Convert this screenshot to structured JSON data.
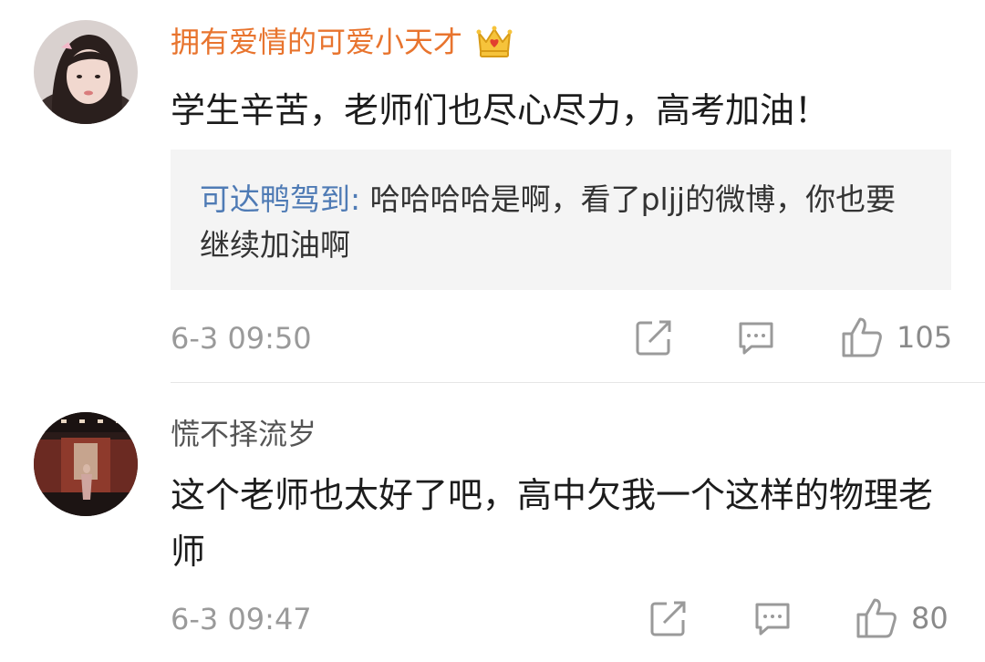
{
  "comments": [
    {
      "username": "拥有爱情的可爱小天才",
      "username_color": "#e8742e",
      "badge_icon": "crown-icon",
      "text": "学生辛苦，老师们也尽心尽力，高考加油！",
      "reply": {
        "author": "可达鸭驾到",
        "separator": ":",
        "text": " 哈哈哈哈是啊，看了pljj的微博，你也要继续加油啊"
      },
      "time": "6-3 09:50",
      "actions": {
        "share_icon": "share-icon",
        "comment_icon": "comment-icon",
        "like_icon": "thumbs-up-icon"
      },
      "likes": "105"
    },
    {
      "username": "慌不择流岁",
      "username_color": "#555555",
      "text": "这个老师也太好了吧，高中欠我一个这样的物理老师",
      "time": "6-3 09:47",
      "actions": {
        "share_icon": "share-icon",
        "comment_icon": "comment-icon",
        "like_icon": "thumbs-up-icon"
      },
      "likes": "80"
    }
  ],
  "colors": {
    "reply_author": "#4f7bb5",
    "meta_text": "#9a9a9a",
    "quote_background": "#f4f4f4"
  }
}
